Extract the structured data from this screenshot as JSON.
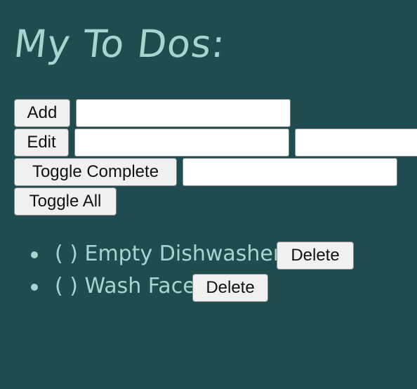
{
  "title": "My To Dos:",
  "controls": {
    "add_label": "Add",
    "edit_label": "Edit",
    "toggle_complete_label": "Toggle Complete",
    "toggle_all_label": "Toggle All",
    "add_input_value": "",
    "edit_input_1_value": "",
    "edit_input_2_value": "",
    "toggle_input_value": ""
  },
  "todos": [
    {
      "status": "( )",
      "text": "Empty Dishwasher",
      "delete_label": "Delete"
    },
    {
      "status": "( )",
      "text": "Wash Face",
      "delete_label": "Delete"
    }
  ],
  "colors": {
    "background": "#1f4d4f",
    "text": "#a6d5cf"
  }
}
